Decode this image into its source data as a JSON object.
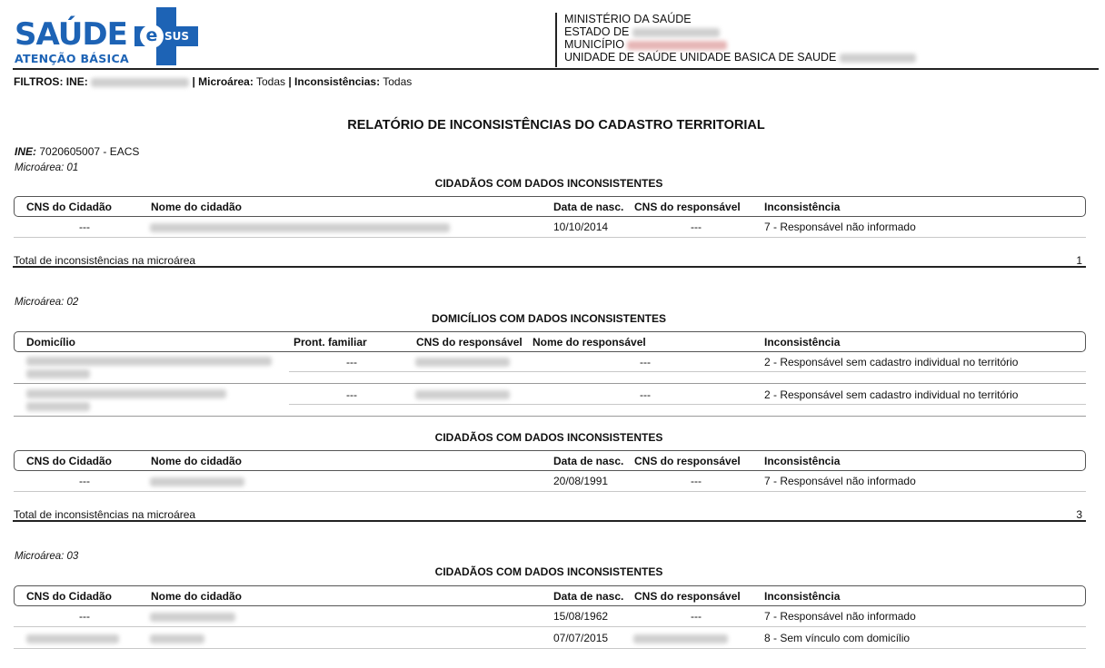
{
  "logo": {
    "brand": "SAÚDE",
    "e_letter": "e",
    "sus": "SUS",
    "subtitle": "ATENÇÃO BÁSICA",
    "color": "#1d63b5"
  },
  "header": {
    "ministry": "MINISTÉRIO DA SAÚDE",
    "estado_label": "ESTADO DE",
    "municipio_label": "MUNICÍPIO",
    "unidade_label": "UNIDADE DE SAÚDE UNIDADE BASICA DE SAUDE"
  },
  "filters": {
    "filtros_label": "FILTROS: INE:",
    "microarea_label": "| Microárea:",
    "microarea_value": "Todas",
    "inconsistencias_label": "| Inconsistências:",
    "inconsistencias_value": "Todas"
  },
  "report_title": "RELATÓRIO DE INCONSISTÊNCIAS DO CADASTRO TERRITORIAL",
  "ine": {
    "label": "INE:",
    "value": "7020605007 - EACS"
  },
  "cidadaos_columns": [
    "CNS do Cidadão",
    "Nome do cidadão",
    "Data de nasc.",
    "CNS do responsável",
    "Inconsistência"
  ],
  "domicilios_columns": [
    "Domicílio",
    "Pront. familiar",
    "CNS do responsável",
    "Nome do responsável",
    "Inconsistência"
  ],
  "sections": {
    "cidadaos_title": "CIDADÃOS COM DADOS INCONSISTENTES",
    "domicilios_title": "DOMICÍLIOS COM DADOS INCONSISTENTES"
  },
  "total_label": "Total de inconsistências na microárea",
  "microareas": [
    {
      "label": "Microárea:",
      "number": "01",
      "total": "1",
      "cidadaos": [
        {
          "cns": "---",
          "data_nasc": "10/10/2014",
          "cns_resp": "---",
          "inconsistencia": "7 - Responsável não informado"
        }
      ]
    },
    {
      "label": "Microárea:",
      "number": "02",
      "total": "3",
      "domicilios": [
        {
          "pront": "---",
          "nome_resp": "---",
          "inconsistencia": "2 - Responsável sem cadastro individual no território"
        },
        {
          "pront": "---",
          "nome_resp": "---",
          "inconsistencia": "2 - Responsável sem cadastro individual no território"
        }
      ],
      "cidadaos": [
        {
          "cns": "---",
          "data_nasc": "20/08/1991",
          "cns_resp": "---",
          "inconsistencia": "7 - Responsável não informado"
        }
      ]
    },
    {
      "label": "Microárea:",
      "number": "03",
      "cidadaos": [
        {
          "cns": "---",
          "data_nasc": "15/08/1962",
          "cns_resp": "---",
          "inconsistencia": "7 - Responsável não informado"
        },
        {
          "data_nasc": "07/07/2015",
          "inconsistencia": "8 - Sem vínculo com domicílio"
        }
      ]
    }
  ]
}
